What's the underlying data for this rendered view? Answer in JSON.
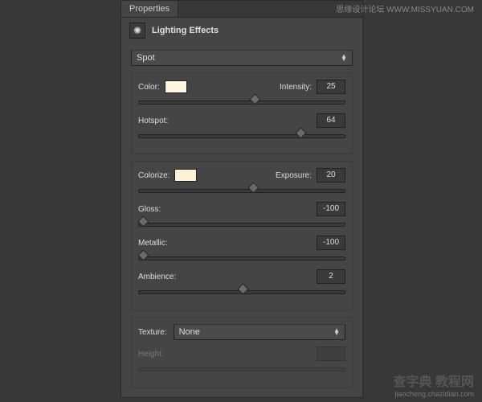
{
  "tab": {
    "label": "Properties"
  },
  "title": "Lighting Effects",
  "lightType": {
    "selected": "Spot"
  },
  "color": {
    "label": "Color:",
    "swatch": "#fdf6e3"
  },
  "intensity": {
    "label": "Intensity:",
    "value": "25",
    "pos": 56
  },
  "hotspot": {
    "label": "Hotspot:",
    "value": "64",
    "pos": 78
  },
  "colorize": {
    "label": "Colorize:",
    "swatch": "#fdf2d8"
  },
  "exposure": {
    "label": "Exposure:",
    "value": "20",
    "pos": 55
  },
  "gloss": {
    "label": "Gloss:",
    "value": "-100",
    "pos": 2
  },
  "metallic": {
    "label": "Metallic:",
    "value": "-100",
    "pos": 2
  },
  "ambience": {
    "label": "Ambience:",
    "value": "2",
    "pos": 50
  },
  "texture": {
    "label": "Texture:",
    "selected": "None"
  },
  "height": {
    "label": "Height:",
    "value": ""
  },
  "watermark": {
    "tr": "思缘设计论坛  WWW.MISSYUAN.COM",
    "br_big": "查字典 教程网",
    "br_small": "jiaocheng.chazidian.com"
  }
}
